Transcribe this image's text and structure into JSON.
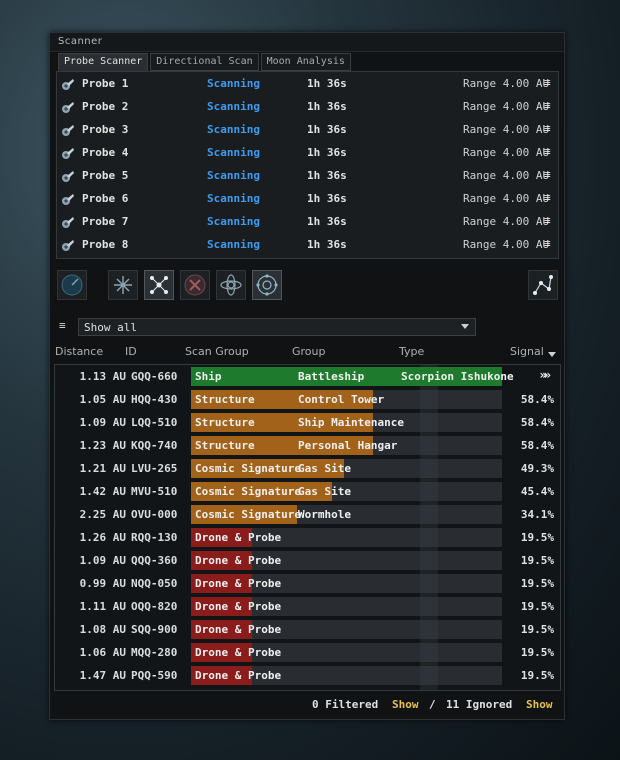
{
  "window": {
    "title": "Scanner"
  },
  "tabs": [
    {
      "label": "Probe Scanner",
      "active": true
    },
    {
      "label": "Directional Scan",
      "active": false
    },
    {
      "label": "Moon Analysis",
      "active": false
    }
  ],
  "probes": [
    {
      "name": "Probe 1",
      "status": "Scanning",
      "time": "1h 36s",
      "range": "Range 4.00 AU"
    },
    {
      "name": "Probe 2",
      "status": "Scanning",
      "time": "1h 36s",
      "range": "Range 4.00 AU"
    },
    {
      "name": "Probe 3",
      "status": "Scanning",
      "time": "1h 36s",
      "range": "Range 4.00 AU"
    },
    {
      "name": "Probe 4",
      "status": "Scanning",
      "time": "1h 36s",
      "range": "Range 4.00 AU"
    },
    {
      "name": "Probe 5",
      "status": "Scanning",
      "time": "1h 36s",
      "range": "Range 4.00 AU"
    },
    {
      "name": "Probe 6",
      "status": "Scanning",
      "time": "1h 36s",
      "range": "Range 4.00 AU"
    },
    {
      "name": "Probe 7",
      "status": "Scanning",
      "time": "1h 36s",
      "range": "Range 4.00 AU"
    },
    {
      "name": "Probe 8",
      "status": "Scanning",
      "time": "1h 36s",
      "range": "Range 4.00 AU"
    }
  ],
  "probe_menu_glyph": "≡",
  "toolbar": {
    "buttons": [
      "clock-icon",
      "spread-icon",
      "pinpoint-icon",
      "recall-icon",
      "center-icon",
      "orbit-icon",
      "map-icon"
    ]
  },
  "filter": {
    "menu_glyph": "≡",
    "selected": "Show all"
  },
  "columns": {
    "distance": "Distance",
    "id": "ID",
    "scan_group": "Scan Group",
    "group": "Group",
    "type": "Type",
    "signal": "Signal"
  },
  "results": [
    {
      "distance": "1.13 AU",
      "id": "GQQ-660",
      "scan_group": "Ship",
      "group": "Battleship",
      "type": "Scorpion Ishukone",
      "signal": "",
      "warp": "»»",
      "fill": 1.0,
      "color": "#1e7a2c"
    },
    {
      "distance": "1.05 AU",
      "id": "HQQ-430",
      "scan_group": "Structure",
      "group": "Control Tower",
      "type": "",
      "signal": "58.4%",
      "fill": 0.584,
      "color": "#a3621a"
    },
    {
      "distance": "1.09 AU",
      "id": "LQQ-510",
      "scan_group": "Structure",
      "group": "Ship Maintenance",
      "type": "",
      "signal": "58.4%",
      "fill": 0.584,
      "color": "#a3621a"
    },
    {
      "distance": "1.23 AU",
      "id": "KQQ-740",
      "scan_group": "Structure",
      "group": "Personal Hangar",
      "type": "",
      "signal": "58.4%",
      "fill": 0.584,
      "color": "#a3621a"
    },
    {
      "distance": "1.21 AU",
      "id": "LVU-265",
      "scan_group": "Cosmic Signature",
      "group": "Gas Site",
      "type": "",
      "signal": "49.3%",
      "fill": 0.493,
      "color": "#a3621a"
    },
    {
      "distance": "1.42 AU",
      "id": "MVU-510",
      "scan_group": "Cosmic Signature",
      "group": "Gas Site",
      "type": "",
      "signal": "45.4%",
      "fill": 0.454,
      "color": "#a3621a"
    },
    {
      "distance": "2.25 AU",
      "id": "OVU-000",
      "scan_group": "Cosmic Signature",
      "group": "Wormhole",
      "type": "",
      "signal": "34.1%",
      "fill": 0.341,
      "color": "#a3621a"
    },
    {
      "distance": "1.26 AU",
      "id": "RQQ-130",
      "scan_group": "Drone & Probe",
      "group": "",
      "type": "",
      "signal": "19.5%",
      "fill": 0.195,
      "color": "#8a1c1c"
    },
    {
      "distance": "1.09 AU",
      "id": "QQQ-360",
      "scan_group": "Drone & Probe",
      "group": "",
      "type": "",
      "signal": "19.5%",
      "fill": 0.195,
      "color": "#8a1c1c"
    },
    {
      "distance": "0.99 AU",
      "id": "NQQ-050",
      "scan_group": "Drone & Probe",
      "group": "",
      "type": "",
      "signal": "19.5%",
      "fill": 0.195,
      "color": "#8a1c1c"
    },
    {
      "distance": "1.11 AU",
      "id": "OQQ-820",
      "scan_group": "Drone & Probe",
      "group": "",
      "type": "",
      "signal": "19.5%",
      "fill": 0.195,
      "color": "#8a1c1c"
    },
    {
      "distance": "1.08 AU",
      "id": "SQQ-900",
      "scan_group": "Drone & Probe",
      "group": "",
      "type": "",
      "signal": "19.5%",
      "fill": 0.195,
      "color": "#8a1c1c"
    },
    {
      "distance": "1.06 AU",
      "id": "MQQ-280",
      "scan_group": "Drone & Probe",
      "group": "",
      "type": "",
      "signal": "19.5%",
      "fill": 0.195,
      "color": "#8a1c1c"
    },
    {
      "distance": "1.47 AU",
      "id": "PQQ-590",
      "scan_group": "Drone & Probe",
      "group": "",
      "type": "",
      "signal": "19.5%",
      "fill": 0.195,
      "color": "#8a1c1c"
    }
  ],
  "footer": {
    "filtered": "0 Filtered",
    "show1": "Show",
    "separator": "/",
    "ignored": "11 Ignored",
    "show2": "Show"
  },
  "colors": {
    "scanning": "#3d9cf2",
    "show_link": "#e8c24a"
  }
}
